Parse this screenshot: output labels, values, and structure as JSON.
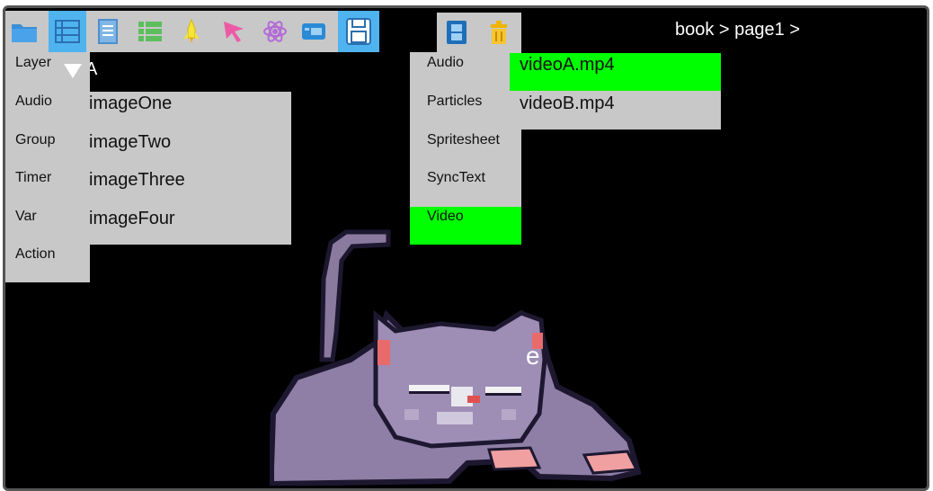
{
  "toolbar_left": {
    "buttons": [
      {
        "name": "folder-icon",
        "active": false
      },
      {
        "name": "list-icon",
        "active": true
      },
      {
        "name": "page-icon",
        "active": false
      },
      {
        "name": "table-icon",
        "active": false
      },
      {
        "name": "rocket-icon",
        "active": false
      },
      {
        "name": "cursor-icon",
        "active": false
      },
      {
        "name": "atom-icon",
        "active": false
      },
      {
        "name": "card-icon",
        "active": false
      },
      {
        "name": "save-page-icon",
        "active": true
      }
    ]
  },
  "toolbar_right": {
    "buttons": [
      {
        "name": "film-icon"
      },
      {
        "name": "trash-icon"
      }
    ]
  },
  "breadcrumb": "book > page1 >",
  "left_menu": {
    "items": [
      "Layer",
      "Audio",
      "Group",
      "Timer",
      "Var",
      "Action"
    ]
  },
  "image_submenu": {
    "items": [
      "imageOne",
      "imageTwo",
      "imageThree",
      "imageFour"
    ]
  },
  "media_menu": {
    "items": [
      "Audio",
      "Particles",
      "Spritesheet",
      "SyncText",
      "Video"
    ],
    "selected": "Video"
  },
  "video_submenu": {
    "items": [
      "videoA.mp4",
      "videoB.mp4"
    ],
    "selected": "videoA.mp4"
  },
  "colors": {
    "accent": "#4fb3f0",
    "selection": "#00ff00",
    "menu_bg": "#c8c8c8",
    "canvas_bg": "#000000"
  }
}
